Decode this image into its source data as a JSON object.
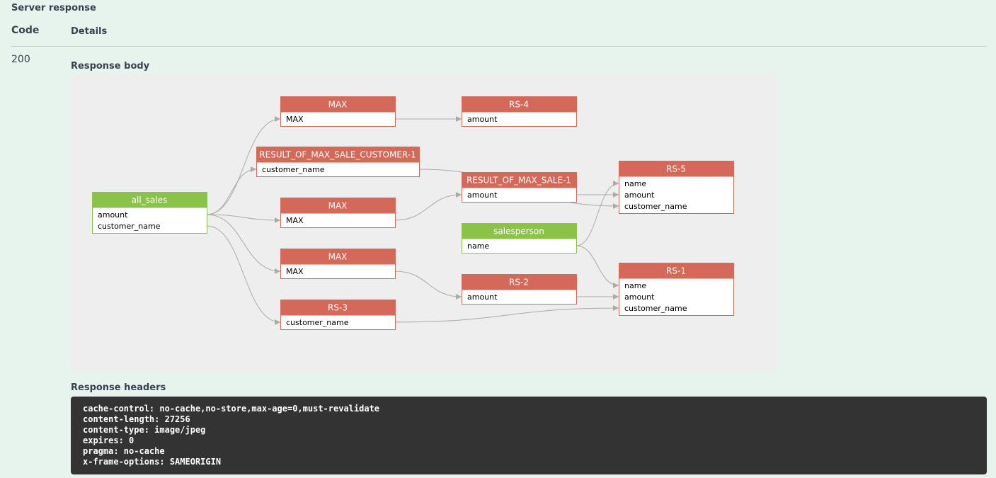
{
  "server_response": {
    "title": "Server response",
    "code_header": "Code",
    "details_header": "Details",
    "status_code": "200",
    "response_body_label": "Response body",
    "response_headers_label": "Response headers",
    "headers": [
      "cache-control: no-cache,no-store,max-age=0,must-revalidate",
      "content-length: 27256",
      "content-type: image/jpeg",
      "expires: 0",
      "pragma: no-cache",
      "x-frame-options: SAMEORIGIN"
    ]
  },
  "lineage_graph": {
    "colors": {
      "source": "#8bc34a",
      "derived": "#d4695a",
      "edge": "#aaaaaa",
      "panel": "#eeeeee"
    },
    "nodes": [
      {
        "id": "all_sales",
        "title": "all_sales",
        "kind": "source",
        "fields": [
          "amount",
          "customer_name"
        ]
      },
      {
        "id": "max_a",
        "title": "MAX",
        "kind": "derived",
        "fields": [
          "MAX"
        ]
      },
      {
        "id": "result_cust",
        "title": "RESULT_OF_MAX_SALE_CUSTOMER-1",
        "kind": "derived",
        "fields": [
          "customer_name"
        ]
      },
      {
        "id": "max_b",
        "title": "MAX",
        "kind": "derived",
        "fields": [
          "MAX"
        ]
      },
      {
        "id": "max_c",
        "title": "MAX",
        "kind": "derived",
        "fields": [
          "MAX"
        ]
      },
      {
        "id": "rs3",
        "title": "RS-3",
        "kind": "derived",
        "fields": [
          "customer_name"
        ]
      },
      {
        "id": "rs4",
        "title": "RS-4",
        "kind": "derived",
        "fields": [
          "amount"
        ]
      },
      {
        "id": "result_sale",
        "title": "RESULT_OF_MAX_SALE-1",
        "kind": "derived",
        "fields": [
          "amount"
        ]
      },
      {
        "id": "salesperson",
        "title": "salesperson",
        "kind": "source",
        "fields": [
          "name"
        ]
      },
      {
        "id": "rs2",
        "title": "RS-2",
        "kind": "derived",
        "fields": [
          "amount"
        ]
      },
      {
        "id": "rs5",
        "title": "RS-5",
        "kind": "derived",
        "fields": [
          "name",
          "amount",
          "customer_name"
        ]
      },
      {
        "id": "rs1",
        "title": "RS-1",
        "kind": "derived",
        "fields": [
          "name",
          "amount",
          "customer_name"
        ]
      }
    ],
    "edges": [
      {
        "from": "all_sales.amount",
        "to": "max_a.MAX"
      },
      {
        "from": "all_sales.amount",
        "to": "result_cust.customer_name"
      },
      {
        "from": "all_sales.amount",
        "to": "max_b.MAX"
      },
      {
        "from": "all_sales.amount",
        "to": "max_c.MAX"
      },
      {
        "from": "all_sales.customer_name",
        "to": "rs3.customer_name"
      },
      {
        "from": "max_a.MAX",
        "to": "rs4.amount"
      },
      {
        "from": "max_b.MAX",
        "to": "result_sale.amount"
      },
      {
        "from": "max_c.MAX",
        "to": "rs2.amount"
      },
      {
        "from": "result_cust.customer_name",
        "to": "rs5.customer_name"
      },
      {
        "from": "result_sale.amount",
        "to": "rs5.amount"
      },
      {
        "from": "salesperson.name",
        "to": "rs5.name"
      },
      {
        "from": "salesperson.name",
        "to": "rs1.name"
      },
      {
        "from": "rs2.amount",
        "to": "rs1.amount"
      },
      {
        "from": "rs3.customer_name",
        "to": "rs1.customer_name"
      }
    ]
  }
}
